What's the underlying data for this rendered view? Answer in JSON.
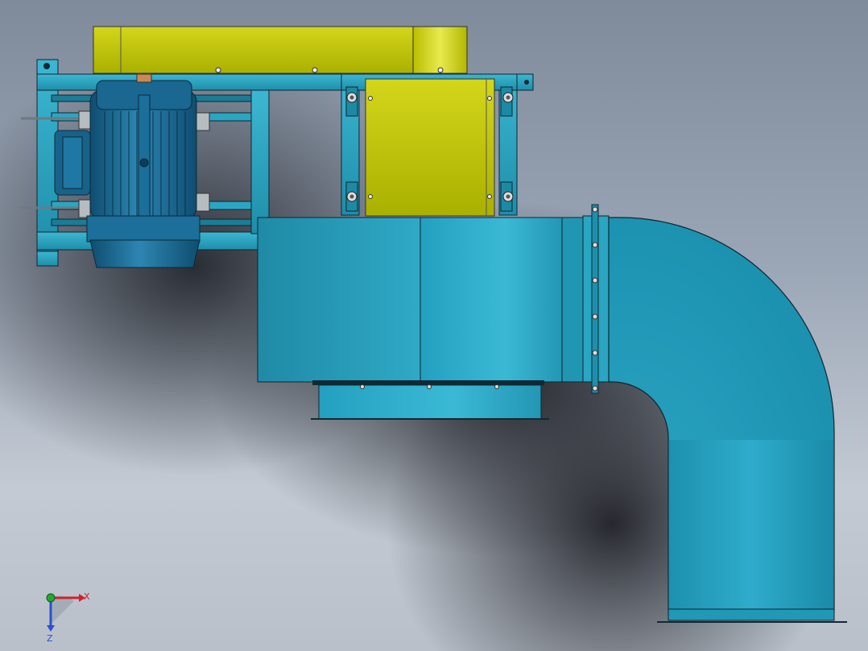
{
  "triad": {
    "x_label": "X",
    "z_label": "Z",
    "x_color": "#d4202a",
    "z_color": "#2a4fd4",
    "y_color": "#22a833"
  },
  "colors": {
    "frame": "#2aa6c3",
    "frame_dark": "#1b7c95",
    "housing": "#2b9fbd",
    "guard": "#c2c400",
    "motor": "#1b6f9a",
    "edge": "#102530"
  }
}
